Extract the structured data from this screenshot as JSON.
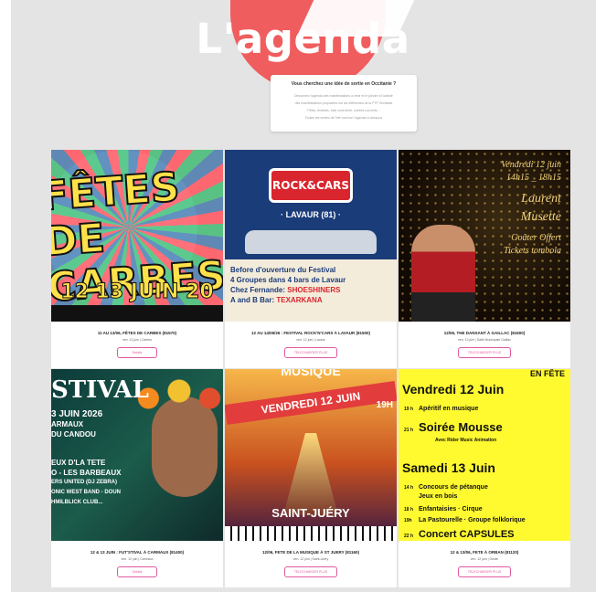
{
  "header": {
    "title": "L'agenda",
    "intro_question": "Vous cherchez une idée de sortie en Occitanie ?",
    "intro_lines": [
      "Découvrez l'agenda des manifestations à venir et le joindre à l'activité",
      "des manifestations proposées sur les différentes de la FTP Occitanie",
      "Fêtes, festivals, bals sous tente, soirées concerts...",
      "Toutes les sorties de l'été sont sur l'agenda ci-dessous"
    ]
  },
  "events": [
    {
      "title": "11 au 13/06, FÊTES de CARBES (81570)",
      "meta": "ven. 12 juin | Carbes",
      "button": "Details",
      "image_text": {
        "big": "FÊTES DE CARBES",
        "date": "12 13 JUIN 20"
      }
    },
    {
      "title": "12 au 14/06/26 : Festival ROCK'N'CARS à LAVAUR (81500)",
      "meta": "ven. 12 juin | Lavaur",
      "button": "TELECHARGER PLUS",
      "image_text": {
        "logo": "ROCK&CARS",
        "sub": "· LAVAUR (81) ·",
        "line1": "Before d'ouverture du Festival",
        "line2": "4 Groupes dans 4 bars de Lavaur",
        "line3a": "Chez Fernande: ",
        "line3b": "SHOESHINERS",
        "line4a": "A and B Bar: ",
        "line4b": "TEXARKANA"
      }
    },
    {
      "title": "12/06, THE DANSANT à GAILLAC (81600)",
      "meta": "ven. 12 juin | Salle Municipale Gaillac",
      "button": "TELECHARGER PLUS",
      "image_text": {
        "l1": "Vendredi 12 juin",
        "l2": "14h15 _ 18h15",
        "l3": "Laurent",
        "l4": "Musette",
        "l5": "Goûter Offert",
        "l6": "Tickets tombola"
      }
    },
    {
      "title": "12 & 13 JUIN : FUT'STIVAL à CARMAUX (81400)",
      "meta": "ven. 12 juin | Carmaux",
      "button": "Details",
      "image_text": {
        "x": "STIVAL",
        "l1": "3 JUIN 2026",
        "l2": "ARMAUX",
        "l3": "DU CANDOU",
        "l4": "EUX D'LA TETE",
        "l5": "O - LES BARBEAUX",
        "l6": "ERS UNITED (DJ ZEBRA)",
        "l7": "ONIC WEST BAND - DOUN",
        "l8": "HMILBLICK CLUB..."
      }
    },
    {
      "title": "12/06, FETE DE LA MUSIQUE à ST JUERY (81160)",
      "meta": "ven. 12 juin | Saint-Juéry",
      "button": "TELECHARGER PLUS",
      "image_text": {
        "musi": "MUSIQUE",
        "ban": "VENDREDI 12 JUIN",
        "h": "19H",
        "place": "SAINT-JUÉRY"
      }
    },
    {
      "title": "12 & 13/06, FETE à ORBAN (81120)",
      "meta": "ven. 12 juin | Orban",
      "button": "TELECHARGER PLUS",
      "image_text": {
        "top": "EN FÊTE",
        "d1": "Vendredi 12 Juin",
        "r1t": "19 h",
        "r1": "Apéritif en musique",
        "r2t": "21 h",
        "r2": "Soirée Mousse",
        "r2s": "Avec Rider Music Animation",
        "d2": "Samedi 13 Juin",
        "r3t": "14 h",
        "r3": "Concours de pétanque",
        "r3b": "Jeux en bois",
        "r4t": "18 h",
        "r4": "Enfantaisies · Cirque",
        "r5t": "19h",
        "r5": "La Pastourelle · Groupe folklorique",
        "r6t": "22 h",
        "r6": "Concert CAPSULES"
      }
    }
  ],
  "colors": {
    "accent": "#e05a9e",
    "brand_red": "#f05d5e",
    "panel": "#e4e4e4"
  }
}
